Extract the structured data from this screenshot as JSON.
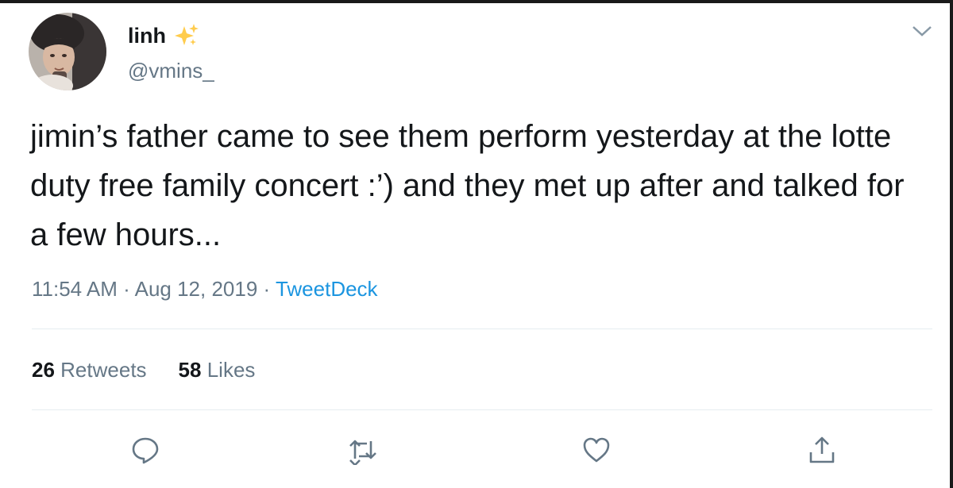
{
  "author": {
    "display_name": "linh",
    "handle": "@vmins_",
    "name_emoji": "sparkles-icon"
  },
  "tweet": {
    "text": "jimin’s father came to see them perform yesterday at the lotte duty free family concert :’) and they met up after and talked for a few hours...",
    "time": "11:54 AM",
    "separator": " · ",
    "date": "Aug 12, 2019",
    "source": "TweetDeck"
  },
  "stats": {
    "retweets_count": "26",
    "retweets_label": "Retweets",
    "likes_count": "58",
    "likes_label": "Likes"
  },
  "actions": [
    "reply-icon",
    "retweet-icon",
    "like-icon",
    "share-icon"
  ],
  "colors": {
    "text": "#14171a",
    "secondary": "#657786",
    "link": "#1b95e0",
    "sparkle": "#ffcc4d",
    "divider": "#e6ecf0"
  }
}
